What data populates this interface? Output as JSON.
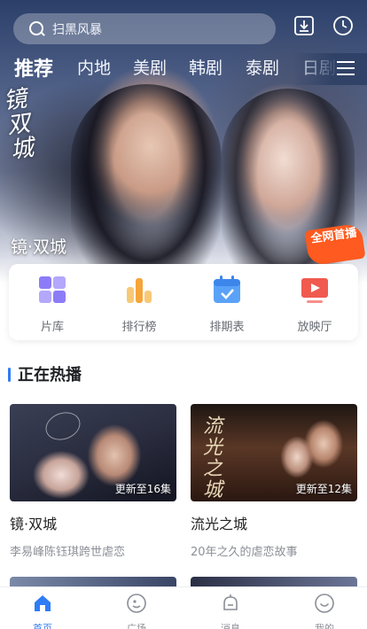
{
  "search": {
    "placeholder": "扫黑风暴"
  },
  "top_icons": [
    "download-icon",
    "history-icon"
  ],
  "tabs": [
    {
      "label": "推荐",
      "active": true
    },
    {
      "label": "内地"
    },
    {
      "label": "美剧"
    },
    {
      "label": "韩剧"
    },
    {
      "label": "泰剧"
    },
    {
      "label": "日剧"
    }
  ],
  "hero": {
    "calligraphy": "镜双城",
    "title": "镜·双城",
    "badge": "全网首播"
  },
  "quick_links": [
    {
      "label": "片库",
      "icon": "grid-icon"
    },
    {
      "label": "排行榜",
      "icon": "bar-chart-icon"
    },
    {
      "label": "排期表",
      "icon": "calendar-icon"
    },
    {
      "label": "放映厅",
      "icon": "play-screen-icon"
    }
  ],
  "section": {
    "title": "正在热播"
  },
  "cards": [
    {
      "title": "镜·双城",
      "subtitle": "李易峰陈钰琪跨世虐恋",
      "tag": "更新至16集"
    },
    {
      "title": "流光之城",
      "subtitle": "20年之久的虐恋故事",
      "tag": "更新至12集",
      "thumb_text": "流光之城"
    }
  ],
  "bottom_nav": [
    {
      "label": "首页",
      "icon": "home-icon",
      "active": true
    },
    {
      "label": "广场",
      "icon": "planet-icon"
    },
    {
      "label": "消息",
      "icon": "bell-icon"
    },
    {
      "label": "我的",
      "icon": "smile-icon"
    }
  ],
  "colors": {
    "accent": "#2f7cf6",
    "badge": "#ff5a1f"
  }
}
